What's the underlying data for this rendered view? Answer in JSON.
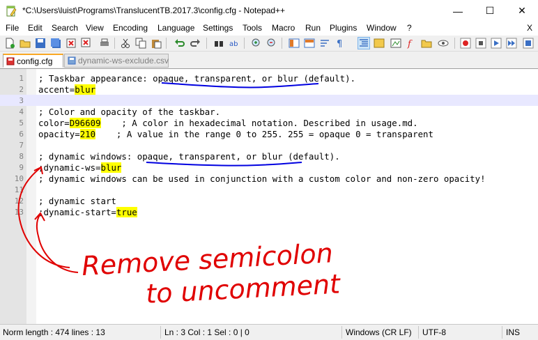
{
  "window": {
    "title": "*C:\\Users\\luist\\Programs\\TranslucentTB.2017.3\\config.cfg - Notepad++",
    "minimize": "—",
    "maximize": "☐",
    "close": "✕"
  },
  "menu": {
    "items": [
      "File",
      "Edit",
      "Search",
      "View",
      "Encoding",
      "Language",
      "Settings",
      "Tools",
      "Macro",
      "Run",
      "Plugins",
      "Window",
      "?"
    ],
    "close": "X"
  },
  "tabs": [
    {
      "label": "config.cfg"
    },
    {
      "label": "dynamic-ws-exclude.csv"
    }
  ],
  "editor": {
    "lines": [
      {
        "num": "1",
        "text": "; Taskbar appearance: opaque, transparent, or blur (default).",
        "pre": "",
        "hl": "",
        "post": ""
      },
      {
        "num": "2",
        "text": "",
        "pre": "accent=",
        "hl": "blur",
        "post": ""
      },
      {
        "num": "3",
        "text": "",
        "pre": "",
        "hl": "",
        "post": ""
      },
      {
        "num": "4",
        "text": "; Color and opacity of the taskbar.",
        "pre": "",
        "hl": "",
        "post": ""
      },
      {
        "num": "5",
        "text": "",
        "pre": "color=",
        "hl": "D96609",
        "post": "    ; A color in hexadecimal notation. Described in usage.md."
      },
      {
        "num": "6",
        "text": "",
        "pre": "opacity=",
        "hl": "210",
        "post": "    ; A value in the range 0 to 255. 255 = opaque 0 = transparent"
      },
      {
        "num": "7",
        "text": "",
        "pre": "",
        "hl": "",
        "post": ""
      },
      {
        "num": "8",
        "text": "; dynamic windows: opaque, transparent, or blur (default).",
        "pre": "",
        "hl": "",
        "post": ""
      },
      {
        "num": "9",
        "text": "",
        "pre": ";dynamic-ws=",
        "hl": "blur",
        "post": ""
      },
      {
        "num": "10",
        "text": "; dynamic windows can be used in conjunction with a custom color and non-zero opacity!",
        "pre": "",
        "hl": "",
        "post": ""
      },
      {
        "num": "11",
        "text": "",
        "pre": "",
        "hl": "",
        "post": ""
      },
      {
        "num": "12",
        "text": "; dynamic start",
        "pre": "",
        "hl": "",
        "post": ""
      },
      {
        "num": "13",
        "text": "",
        "pre": ";dynamic-start=",
        "hl": "true",
        "post": ""
      }
    ],
    "current_line": 3
  },
  "annotation": {
    "line1": "Remove semicolon",
    "line2": "to uncomment",
    "ink_color": "#e00000",
    "underline_color": "#0000e0"
  },
  "status": {
    "doc": "Norm length : 474   lines : 13",
    "pos": "Ln : 3   Col : 1   Sel : 0 | 0",
    "eol": "Windows (CR LF)",
    "enc": "UTF-8",
    "mode": "INS"
  },
  "colors": {
    "highlight": "#ffff00",
    "current_line": "#e8e8ff",
    "tab_accent": "#f9a825"
  }
}
